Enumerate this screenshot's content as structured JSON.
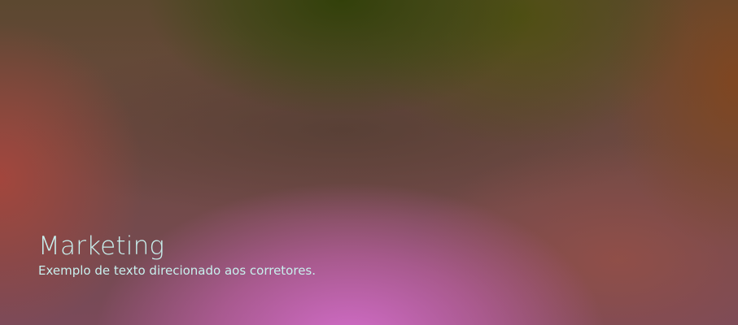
{
  "banner": {
    "title": "Marketing",
    "subtitle": "Exemplo de texto direcionado aos corretores."
  },
  "colors": {
    "text": "#c8f0ee",
    "pink_glow": "#d66ece",
    "olive_top": "#304008",
    "red_left": "#a8463c"
  }
}
